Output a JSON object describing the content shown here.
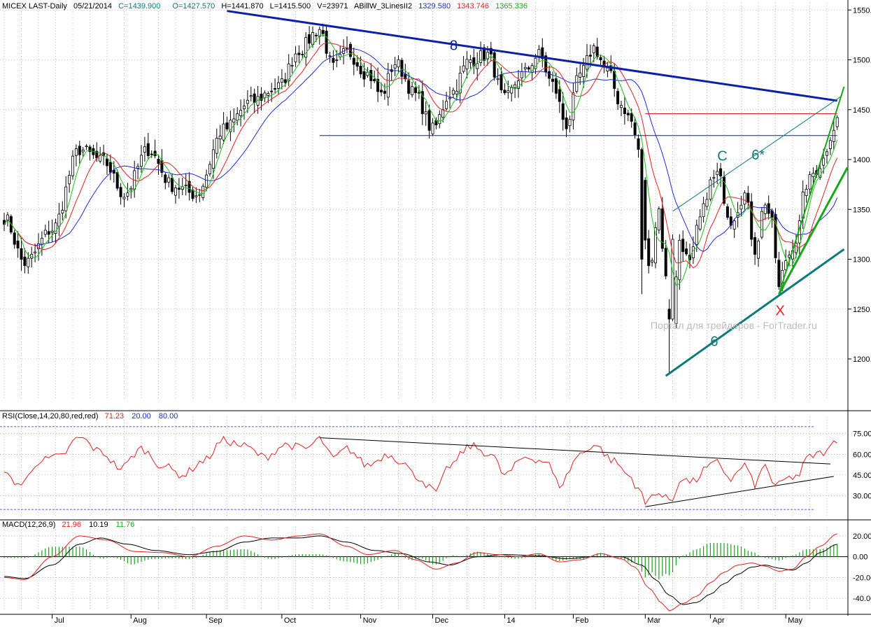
{
  "chart_data": {
    "type": "candlestick",
    "header": {
      "symbol": "MICEX LAST-Daily",
      "date": "05/21/2014",
      "close": "C=1439.900",
      "open": "O=1427.570",
      "high": "H=1441.870",
      "low": "L=1415.500",
      "volume": "V=23971",
      "indicator": "ABillW_3LinesII2",
      "ind_val1": "1329.580",
      "ind_val2": "1343.746",
      "ind_val3": "1365.336"
    },
    "colors": {
      "blue_line": "#1c2bd6",
      "red_line": "#e02020",
      "green_line": "#18c018",
      "trend_navy": "#0a1faa",
      "wave_teal": "#0e7a7a",
      "wave_green": "#16a816",
      "rsi_red": "#e02020",
      "macd_hist": "#1aa01a"
    },
    "price_axis": {
      "ylim": [
        1160,
        1560
      ],
      "ticks": [
        {
          "v": 1550,
          "label": "1550.00"
        },
        {
          "v": 1500,
          "label": "1500.00"
        },
        {
          "v": 1450,
          "label": "1450.00"
        },
        {
          "v": 1400,
          "label": "1400.00"
        },
        {
          "v": 1350,
          "label": "1350.00"
        },
        {
          "v": 1300,
          "label": "1300.00"
        },
        {
          "v": 1250,
          "label": "1250.00"
        },
        {
          "v": 1200,
          "label": "1200.00"
        }
      ]
    },
    "x_axis": {
      "months": [
        {
          "label": "Jul",
          "i": 14
        },
        {
          "label": "Aug",
          "i": 37
        },
        {
          "label": "Sep",
          "i": 59
        },
        {
          "label": "Oct",
          "i": 81
        },
        {
          "label": "Nov",
          "i": 104
        },
        {
          "label": "Dec",
          "i": 125
        },
        {
          "label": "14",
          "i": 146
        },
        {
          "label": "Feb",
          "i": 166
        },
        {
          "label": "Mar",
          "i": 187
        },
        {
          "label": "Apr",
          "i": 206
        },
        {
          "label": "May",
          "i": 228
        }
      ]
    },
    "horizontal_lines": [
      {
        "value": 1424,
        "color": "#0a1faa",
        "i_from": 92,
        "i_to": 243
      },
      {
        "value": 1446,
        "color": "#e02020",
        "i_from": 187,
        "i_to": 243
      }
    ],
    "trendlines": [
      {
        "name": "8",
        "color": "#0a1faa",
        "width": 3,
        "from": [
          65,
          1549
        ],
        "to": [
          243,
          1459
        ]
      },
      {
        "name": "6",
        "color": "#0e7a7a",
        "width": 3,
        "from": [
          193,
          1183
        ],
        "to": [
          245,
          1310
        ]
      },
      {
        "name": "6*",
        "color": "#0e7a7a",
        "width": 1,
        "from": [
          195,
          1348
        ],
        "to": [
          244,
          1463
        ]
      },
      {
        "name": "upper-wedge",
        "color": "#16a816",
        "width": 2,
        "from": [
          226,
          1265
        ],
        "to": [
          245,
          1473
        ]
      },
      {
        "name": "lower-wedge",
        "color": "#16a816",
        "width": 3,
        "from": [
          226,
          1265
        ],
        "to": [
          246,
          1392
        ]
      }
    ],
    "wave_labels": [
      {
        "text": "8",
        "i": 130,
        "v": 1510,
        "color": "#0a1faa"
      },
      {
        "text": "C",
        "i": 208,
        "v": 1399,
        "color": "#0e7a7a"
      },
      {
        "text": "6*",
        "i": 218,
        "v": 1400,
        "color": "#0e7a7a"
      },
      {
        "text": "6",
        "i": 206,
        "v": 1213,
        "color": "#0e7a7a"
      },
      {
        "text": "X",
        "i": 225,
        "v": 1244,
        "color": "#e02020"
      }
    ],
    "watermark": "Портал для трейдеров - ForTrader.ru",
    "key_points": [
      {
        "i": 0,
        "c": 1342
      },
      {
        "i": 6,
        "c": 1296
      },
      {
        "i": 14,
        "c": 1330
      },
      {
        "i": 22,
        "c": 1410
      },
      {
        "i": 29,
        "c": 1398
      },
      {
        "i": 35,
        "c": 1365
      },
      {
        "i": 42,
        "c": 1410
      },
      {
        "i": 49,
        "c": 1374
      },
      {
        "i": 56,
        "c": 1365
      },
      {
        "i": 64,
        "c": 1430
      },
      {
        "i": 72,
        "c": 1458
      },
      {
        "i": 80,
        "c": 1473
      },
      {
        "i": 86,
        "c": 1510
      },
      {
        "i": 92,
        "c": 1531
      },
      {
        "i": 96,
        "c": 1492
      },
      {
        "i": 100,
        "c": 1508
      },
      {
        "i": 106,
        "c": 1486
      },
      {
        "i": 110,
        "c": 1465
      },
      {
        "i": 114,
        "c": 1497
      },
      {
        "i": 120,
        "c": 1465
      },
      {
        "i": 125,
        "c": 1430
      },
      {
        "i": 130,
        "c": 1466
      },
      {
        "i": 136,
        "c": 1500
      },
      {
        "i": 141,
        "c": 1505
      },
      {
        "i": 146,
        "c": 1460
      },
      {
        "i": 151,
        "c": 1485
      },
      {
        "i": 156,
        "c": 1505
      },
      {
        "i": 160,
        "c": 1475
      },
      {
        "i": 164,
        "c": 1435
      },
      {
        "i": 168,
        "c": 1485
      },
      {
        "i": 172,
        "c": 1512
      },
      {
        "i": 176,
        "c": 1488
      },
      {
        "i": 180,
        "c": 1455
      },
      {
        "i": 183,
        "c": 1438
      },
      {
        "i": 185,
        "c": 1410
      },
      {
        "i": 188,
        "c": 1290
      },
      {
        "i": 191,
        "c": 1350
      },
      {
        "i": 193,
        "c": 1280
      },
      {
        "i": 195,
        "c": 1240
      },
      {
        "i": 197,
        "c": 1320
      },
      {
        "i": 200,
        "c": 1295
      },
      {
        "i": 203,
        "c": 1340
      },
      {
        "i": 206,
        "c": 1376
      },
      {
        "i": 208,
        "c": 1385
      },
      {
        "i": 212,
        "c": 1340
      },
      {
        "i": 216,
        "c": 1365
      },
      {
        "i": 219,
        "c": 1310
      },
      {
        "i": 222,
        "c": 1358
      },
      {
        "i": 224,
        "c": 1335
      },
      {
        "i": 226,
        "c": 1270
      },
      {
        "i": 228,
        "c": 1300
      },
      {
        "i": 231,
        "c": 1320
      },
      {
        "i": 234,
        "c": 1375
      },
      {
        "i": 237,
        "c": 1390
      },
      {
        "i": 239,
        "c": 1400
      },
      {
        "i": 241,
        "c": 1425
      },
      {
        "i": 243,
        "c": 1440
      }
    ],
    "rsi": {
      "label": "RSI(Close,14,20,80,red,red)",
      "val": "71.23",
      "low": "20.00",
      "high": "80.00",
      "ylim": [
        15,
        85
      ],
      "ticks": [
        {
          "v": 75,
          "label": "75.00"
        },
        {
          "v": 60,
          "label": "60.00"
        },
        {
          "v": 45,
          "label": "45.00"
        },
        {
          "v": 30,
          "label": "30.00"
        }
      ],
      "key_points": [
        {
          "i": 0,
          "v": 45
        },
        {
          "i": 5,
          "v": 38
        },
        {
          "i": 10,
          "v": 55
        },
        {
          "i": 16,
          "v": 58
        },
        {
          "i": 22,
          "v": 72
        },
        {
          "i": 28,
          "v": 62
        },
        {
          "i": 34,
          "v": 50
        },
        {
          "i": 40,
          "v": 64
        },
        {
          "i": 46,
          "v": 52
        },
        {
          "i": 52,
          "v": 45
        },
        {
          "i": 58,
          "v": 55
        },
        {
          "i": 64,
          "v": 70
        },
        {
          "i": 70,
          "v": 66
        },
        {
          "i": 76,
          "v": 58
        },
        {
          "i": 82,
          "v": 67
        },
        {
          "i": 88,
          "v": 64
        },
        {
          "i": 92,
          "v": 71
        },
        {
          "i": 96,
          "v": 57
        },
        {
          "i": 100,
          "v": 64
        },
        {
          "i": 106,
          "v": 52
        },
        {
          "i": 112,
          "v": 60
        },
        {
          "i": 116,
          "v": 55
        },
        {
          "i": 120,
          "v": 44
        },
        {
          "i": 126,
          "v": 33
        },
        {
          "i": 130,
          "v": 52
        },
        {
          "i": 136,
          "v": 66
        },
        {
          "i": 142,
          "v": 60
        },
        {
          "i": 146,
          "v": 45
        },
        {
          "i": 152,
          "v": 58
        },
        {
          "i": 158,
          "v": 55
        },
        {
          "i": 162,
          "v": 38
        },
        {
          "i": 168,
          "v": 60
        },
        {
          "i": 172,
          "v": 67
        },
        {
          "i": 178,
          "v": 55
        },
        {
          "i": 182,
          "v": 45
        },
        {
          "i": 185,
          "v": 36
        },
        {
          "i": 187,
          "v": 24
        },
        {
          "i": 190,
          "v": 33
        },
        {
          "i": 193,
          "v": 28
        },
        {
          "i": 195,
          "v": 27
        },
        {
          "i": 197,
          "v": 42
        },
        {
          "i": 201,
          "v": 40
        },
        {
          "i": 205,
          "v": 50
        },
        {
          "i": 208,
          "v": 54
        },
        {
          "i": 212,
          "v": 42
        },
        {
          "i": 216,
          "v": 52
        },
        {
          "i": 219,
          "v": 38
        },
        {
          "i": 222,
          "v": 52
        },
        {
          "i": 225,
          "v": 36
        },
        {
          "i": 228,
          "v": 42
        },
        {
          "i": 232,
          "v": 45
        },
        {
          "i": 234,
          "v": 57
        },
        {
          "i": 237,
          "v": 60
        },
        {
          "i": 240,
          "v": 62
        },
        {
          "i": 243,
          "v": 71
        }
      ],
      "trendlines": [
        {
          "from": [
            92,
            72
          ],
          "to": [
            241,
            53
          ]
        },
        {
          "from": [
            187,
            22
          ],
          "to": [
            242,
            44
          ]
        }
      ]
    },
    "macd": {
      "label": "MACD(12,26,9)",
      "macd_val": "21.96",
      "signal_val": "10.19",
      "hist_val": "11.76",
      "ylim": [
        -52,
        26
      ],
      "ticks": [
        {
          "v": 20,
          "label": "20.00"
        },
        {
          "v": 0,
          "label": "0.00"
        },
        {
          "v": -20,
          "label": "-20.00"
        },
        {
          "v": -40,
          "label": "-40.00"
        }
      ],
      "macd_points": [
        {
          "i": 0,
          "v": -20
        },
        {
          "i": 6,
          "v": -22
        },
        {
          "i": 14,
          "v": 0
        },
        {
          "i": 22,
          "v": 20
        },
        {
          "i": 30,
          "v": 16
        },
        {
          "i": 38,
          "v": 5
        },
        {
          "i": 46,
          "v": 4
        },
        {
          "i": 54,
          "v": 0
        },
        {
          "i": 62,
          "v": 10
        },
        {
          "i": 70,
          "v": 20
        },
        {
          "i": 78,
          "v": 16
        },
        {
          "i": 86,
          "v": 20
        },
        {
          "i": 92,
          "v": 22
        },
        {
          "i": 100,
          "v": 10
        },
        {
          "i": 106,
          "v": 2
        },
        {
          "i": 114,
          "v": 6
        },
        {
          "i": 120,
          "v": -3
        },
        {
          "i": 126,
          "v": -12
        },
        {
          "i": 132,
          "v": -6
        },
        {
          "i": 138,
          "v": 4
        },
        {
          "i": 144,
          "v": 2
        },
        {
          "i": 150,
          "v": 0
        },
        {
          "i": 156,
          "v": 3
        },
        {
          "i": 162,
          "v": -5
        },
        {
          "i": 168,
          "v": -3
        },
        {
          "i": 174,
          "v": 3
        },
        {
          "i": 180,
          "v": -2
        },
        {
          "i": 184,
          "v": -10
        },
        {
          "i": 188,
          "v": -30
        },
        {
          "i": 192,
          "v": -45
        },
        {
          "i": 194,
          "v": -52
        },
        {
          "i": 198,
          "v": -45
        },
        {
          "i": 202,
          "v": -38
        },
        {
          "i": 206,
          "v": -25
        },
        {
          "i": 210,
          "v": -15
        },
        {
          "i": 214,
          "v": -8
        },
        {
          "i": 218,
          "v": -6
        },
        {
          "i": 222,
          "v": -9
        },
        {
          "i": 226,
          "v": -14
        },
        {
          "i": 230,
          "v": -12
        },
        {
          "i": 234,
          "v": 0
        },
        {
          "i": 238,
          "v": 10
        },
        {
          "i": 243,
          "v": 22
        }
      ],
      "signal_points": [
        {
          "i": 0,
          "v": -19
        },
        {
          "i": 6,
          "v": -21
        },
        {
          "i": 14,
          "v": -8
        },
        {
          "i": 22,
          "v": 12
        },
        {
          "i": 28,
          "v": 18
        },
        {
          "i": 36,
          "v": 12
        },
        {
          "i": 44,
          "v": 6
        },
        {
          "i": 54,
          "v": 2
        },
        {
          "i": 62,
          "v": 5
        },
        {
          "i": 70,
          "v": 14
        },
        {
          "i": 78,
          "v": 18
        },
        {
          "i": 86,
          "v": 18
        },
        {
          "i": 92,
          "v": 20
        },
        {
          "i": 100,
          "v": 14
        },
        {
          "i": 108,
          "v": 6
        },
        {
          "i": 116,
          "v": 3
        },
        {
          "i": 124,
          "v": -5
        },
        {
          "i": 130,
          "v": -8
        },
        {
          "i": 138,
          "v": 0
        },
        {
          "i": 146,
          "v": 2
        },
        {
          "i": 156,
          "v": 1
        },
        {
          "i": 164,
          "v": -2
        },
        {
          "i": 172,
          "v": 0
        },
        {
          "i": 180,
          "v": 0
        },
        {
          "i": 186,
          "v": -8
        },
        {
          "i": 190,
          "v": -22
        },
        {
          "i": 194,
          "v": -37
        },
        {
          "i": 198,
          "v": -46
        },
        {
          "i": 202,
          "v": -44
        },
        {
          "i": 206,
          "v": -36
        },
        {
          "i": 210,
          "v": -26
        },
        {
          "i": 214,
          "v": -17
        },
        {
          "i": 218,
          "v": -10
        },
        {
          "i": 222,
          "v": -8
        },
        {
          "i": 226,
          "v": -11
        },
        {
          "i": 230,
          "v": -13
        },
        {
          "i": 234,
          "v": -6
        },
        {
          "i": 238,
          "v": 4
        },
        {
          "i": 243,
          "v": 12
        }
      ]
    }
  }
}
